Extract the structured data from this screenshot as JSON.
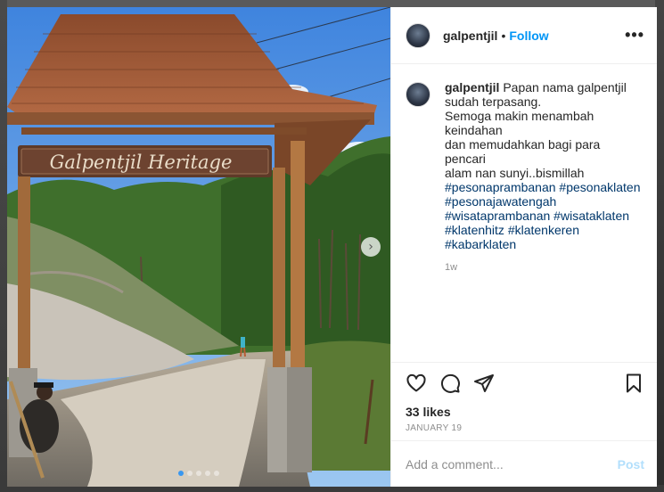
{
  "post": {
    "username": "galpentjil",
    "separator": "•",
    "follow_label": "Follow",
    "more_icon": "more-horizontal-icon",
    "image": {
      "sign_text": "Galpentjil Heritage",
      "next_icon": "chevron-right-icon",
      "slide_count": 5,
      "active_slide": 1
    },
    "caption": {
      "username": "galpentjil",
      "lines": [
        "Papan nama galpentjil",
        "sudah terpasang.",
        "Semoga makin menambah keindahan",
        "dan memudahkan bagi para pencari",
        "alam nan sunyi..bismillah"
      ],
      "hashtag_lines": [
        "#pesonaprambanan #pesonaklaten",
        "#pesonajawatengah",
        "#wisataprambanan #wisataklaten",
        "#klatenhitz #klatenkeren #kabarklaten"
      ],
      "time_ago": "1w"
    },
    "actions": {
      "like_icon": "heart-icon",
      "comment_icon": "comment-icon",
      "share_icon": "paper-plane-icon",
      "save_icon": "bookmark-icon"
    },
    "likes": "33 likes",
    "date": "JANUARY 19",
    "comment_input": {
      "placeholder": "Add a comment...",
      "post_label": "Post"
    },
    "colors": {
      "link": "#0095f6",
      "hashtag": "#00376b",
      "post_disabled": "#b2dffc",
      "muted": "#8e8e8e"
    }
  }
}
